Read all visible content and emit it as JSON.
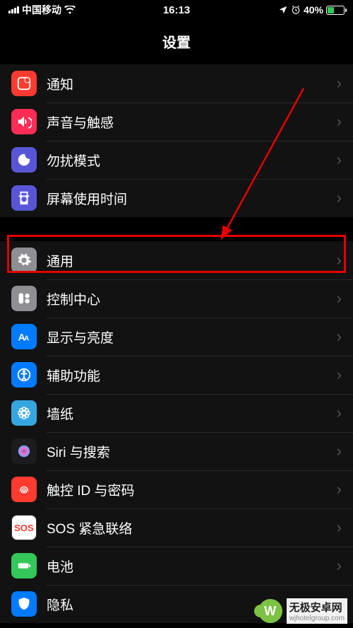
{
  "status": {
    "carrier": "中国移动",
    "time": "16:13",
    "battery_pct": "40%"
  },
  "title": "设置",
  "sections": [
    {
      "rows": [
        {
          "icon": "notification-icon",
          "bg": "#ff3b30",
          "label": "通知"
        },
        {
          "icon": "sound-icon",
          "bg": "#ff2d55",
          "label": "声音与触感"
        },
        {
          "icon": "dnd-icon",
          "bg": "#5856d6",
          "label": "勿扰模式"
        },
        {
          "icon": "screentime-icon",
          "bg": "#5856d6",
          "label": "屏幕使用时间"
        }
      ]
    },
    {
      "rows": [
        {
          "icon": "general-icon",
          "bg": "#8e8e93",
          "label": "通用",
          "highlighted": true
        },
        {
          "icon": "controlcenter-icon",
          "bg": "#8e8e93",
          "label": "控制中心"
        },
        {
          "icon": "display-icon",
          "bg": "#007aff",
          "label": "显示与亮度"
        },
        {
          "icon": "accessibility-icon",
          "bg": "#007aff",
          "label": "辅助功能"
        },
        {
          "icon": "wallpaper-icon",
          "bg": "#36a6e0",
          "label": "墙纸"
        },
        {
          "icon": "siri-icon",
          "bg": "#1c1c1e",
          "label": "Siri 与搜索"
        },
        {
          "icon": "touchid-icon",
          "bg": "#ff3b30",
          "label": "触控 ID 与密码"
        },
        {
          "icon": "sos-icon",
          "bg": "#ff3b30",
          "label": "SOS 紧急联络",
          "sos_text": "SOS"
        },
        {
          "icon": "battery-icon",
          "bg": "#34c759",
          "label": "电池"
        },
        {
          "icon": "privacy-icon",
          "bg": "#007aff",
          "label": "隐私"
        }
      ]
    }
  ],
  "watermark": {
    "logo_letter": "W",
    "brand": "无极安卓网",
    "url": "wjhotelgroup.com"
  }
}
